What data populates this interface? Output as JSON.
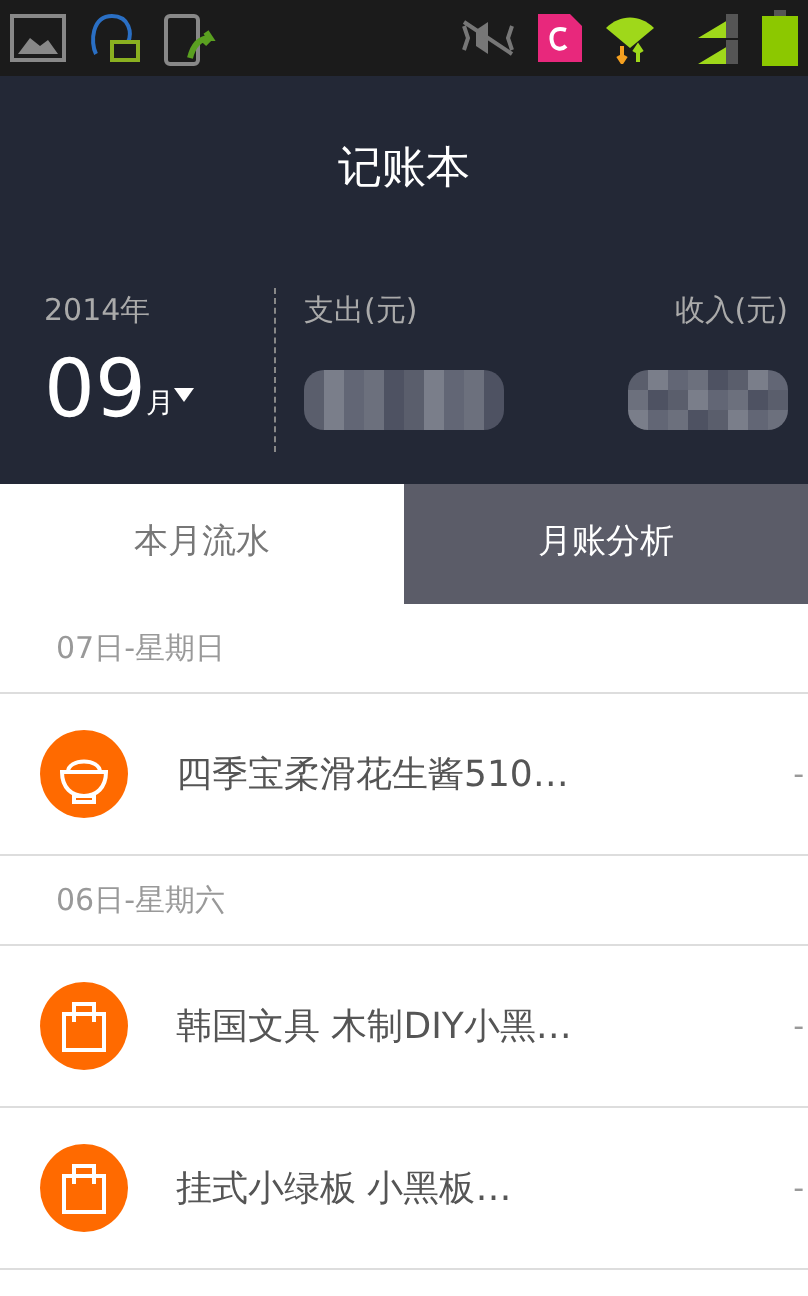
{
  "header": {
    "title": "记账本"
  },
  "summary": {
    "year": "2014年",
    "month": "09",
    "month_unit": "月",
    "expense_label": "支出(元)",
    "income_label": "收入(元)"
  },
  "tabs": [
    {
      "label": "本月流水",
      "selected": true
    },
    {
      "label": "月账分析",
      "selected": false
    }
  ],
  "days": [
    {
      "date": "07日-星期日",
      "entries": [
        {
          "kind": "food",
          "title": "四季宝柔滑花生酱510…",
          "amount": "-"
        }
      ]
    },
    {
      "date": "06日-星期六",
      "entries": [
        {
          "kind": "shopping",
          "title": "韩国文具 木制DIY小黑…",
          "amount": "-"
        },
        {
          "kind": "shopping",
          "title": "挂式小绿板 小黑板…",
          "amount": "-"
        }
      ]
    }
  ]
}
